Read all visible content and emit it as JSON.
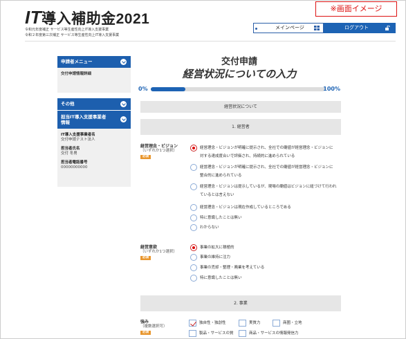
{
  "header": {
    "logo_it": "IT",
    "logo_rest": "導入補助金2021",
    "sub_lines": [
      "令和元年度補正 サービス等生産性向上IT導入支援事業",
      "令和２年度第三次補正 サービス等生産性向上IT導入支援事業"
    ],
    "notice": "※画面イメージ",
    "main_page": "メインページ",
    "logout": "ログアウト"
  },
  "sidebar": {
    "applicant_menu": "申請者メニュー",
    "applicant_items": [
      "交付申請情報詳細"
    ],
    "other": "その他",
    "vendor_head": "担当IT導入支援事業者情報",
    "vendor_name_label": "IT導入支援事業者名",
    "vendor_name": "交付申請テスト法人",
    "staff_label": "担当者氏名",
    "staff": "交付 冬男",
    "phone_label": "担当者電話番号",
    "phone": "00000000000"
  },
  "main": {
    "title1": "交付申請",
    "title2": "経営状況についての入力",
    "progress_start": "0%",
    "progress_end": "100%",
    "progress_value": 0.2,
    "section_top": "経営状況について",
    "section1": "1. 経営者",
    "q1_label": "経営理念・ビジョン",
    "q1_hint": "（いずれか1つ選択）",
    "required": "必須",
    "q1_options": [
      "経営理念・ビジョンが明確に提示され、全社での廟値が経営理念・ビジョンに対する達成度合いで評価され、持続的に進められている",
      "経営理念・ビジョンが明確に提示され、全社での廟値が経営理念・ビジョンに整合的に進められている",
      "経営理念・ビジョンは提示しているが、現場の廟値はビジョンに紐づけて行われているとは言えない",
      "経営理念・ビジョンは現在作成しているところである",
      "特に意識したことは無い",
      "わからない"
    ],
    "q2_label": "経営意欲",
    "q2_hint": "（いずれか1つ選択）",
    "q2_options": [
      "事業の拡大に積極的",
      "事業の維持に注力",
      "事業の売却・整理・廃業を考えている",
      "特に意識したことは無い"
    ],
    "section2": "2. 事業",
    "q3_label": "強み",
    "q3_hint": "（複数選択可）",
    "q3_options": [
      "独自性・独創性",
      "実質力",
      "商圏・立地",
      "製品・サービスの質",
      "商品・サービスの情報発信力"
    ]
  }
}
